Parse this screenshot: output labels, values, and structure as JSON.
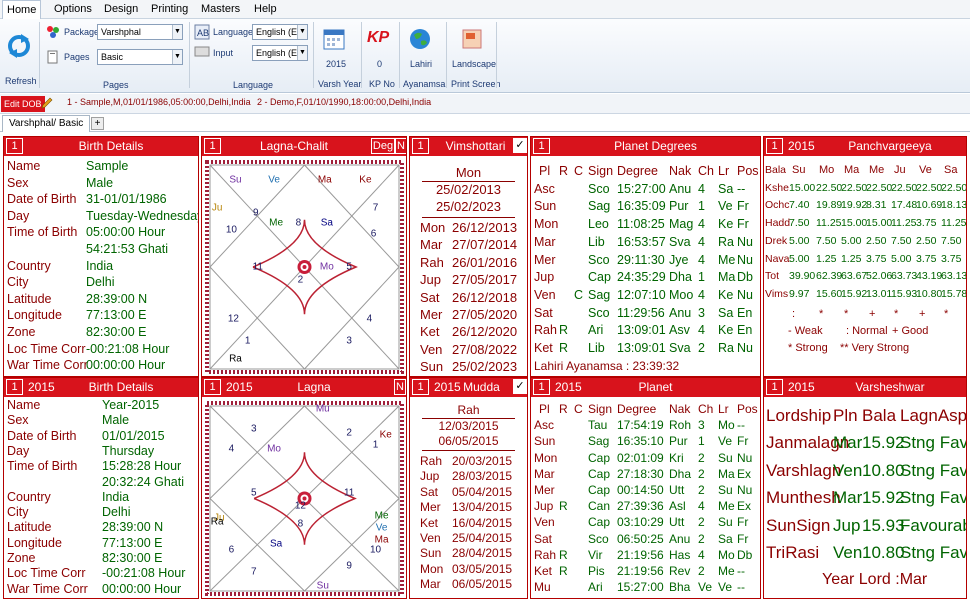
{
  "menu": [
    "Home",
    "Options",
    "Design",
    "Printing",
    "Masters",
    "Help"
  ],
  "ribbon": {
    "refresh": "Refresh",
    "package_label": "Package",
    "package_value": "Varshphal",
    "pages_label": "Pages",
    "pages_value": "Basic",
    "group_pages": "Pages",
    "language_label": "Language",
    "language_value": "English (E",
    "input_label": "Input",
    "input_value": "English (E",
    "group_language": "Language",
    "varsh_year": "2015",
    "varsh_year_label": "Varsh Year",
    "kp_icon": "KP",
    "kp_no": "0",
    "kp_no_label": "KP No",
    "ayanamsa": "Lahiri",
    "ayanamsa_label": "Ayanamsa",
    "print_screen": "Landscape",
    "print_screen_label": "Print Screen"
  },
  "edit_dob": "Edit DOB",
  "profiles": [
    "1 - Sample,M,01/01/1986,05:00:00,Delhi,India",
    "2 - Demo,F,01/10/1990,18:00:00,Delhi,India"
  ],
  "doc_tab": "Varshphal/ Basic",
  "add_tab": "+",
  "p_birth": {
    "num": "1",
    "title": "Birth Details",
    "rows": [
      [
        "Name",
        "Sample"
      ],
      [
        "Sex",
        "Male"
      ],
      [
        "Date of Birth",
        "31-01/01/1986"
      ],
      [
        "Day",
        "Tuesday-Wednesday"
      ],
      [
        "Time of Birth",
        "05:00:00 Hour"
      ],
      [
        "",
        "54:21:53 Ghati"
      ],
      [
        "Country",
        "India"
      ],
      [
        "City",
        "Delhi"
      ],
      [
        "Latitude",
        "28:39:00 N"
      ],
      [
        "Longitude",
        "77:13:00 E"
      ],
      [
        "Zone",
        "82:30:00 E"
      ],
      [
        "Loc Time Corr",
        "-00:21:08 Hour"
      ],
      [
        "War Time Corr",
        "00:00:00 Hour"
      ]
    ]
  },
  "p_chalit": {
    "num": "1",
    "title": "Lagna-Chalit",
    "deg": "Deg",
    "n": "N",
    "houses": [
      "11",
      "2",
      "12",
      "5",
      "1",
      "10",
      "4",
      "3",
      "7",
      "8",
      "6",
      "9"
    ],
    "planets": [
      {
        "t": "Su",
        "c": "#7030a0"
      },
      {
        "t": "Ve",
        "c": "#1f6fb0"
      },
      {
        "t": "Ma",
        "c": "#8b0000"
      },
      {
        "t": "Ke",
        "c": "#8b0000"
      },
      {
        "t": "Ju",
        "c": "#b8860b"
      },
      {
        "t": "Me",
        "c": "#006400"
      },
      {
        "t": "Sa",
        "c": "#000080"
      },
      {
        "t": "Mo",
        "c": "#7030a0"
      },
      {
        "t": "Ra",
        "c": "#000000"
      }
    ]
  },
  "p_vim": {
    "num": "1",
    "title": "Vimshottari",
    "check": "✓",
    "head": "Mon",
    "range": [
      "25/02/2013",
      "25/02/2023"
    ],
    "rows": [
      [
        "Mon",
        "26/12/2013"
      ],
      [
        "Mar",
        "27/07/2014"
      ],
      [
        "Rah",
        "26/01/2016"
      ],
      [
        "Jup",
        "27/05/2017"
      ],
      [
        "Sat",
        "26/12/2018"
      ],
      [
        "Mer",
        "27/05/2020"
      ],
      [
        "Ket",
        "26/12/2020"
      ],
      [
        "Ven",
        "27/08/2022"
      ],
      [
        "Sun",
        "25/02/2023"
      ]
    ]
  },
  "p_pdeg": {
    "num": "1",
    "title": "Planet Degrees",
    "cols": [
      "Pl",
      "R",
      "C",
      "Sign",
      "Degree",
      "Nak",
      "Ch",
      "Lr",
      "Pos"
    ],
    "rows": [
      [
        "Asc",
        "",
        "",
        "Sco",
        "15:27:00",
        "Anu",
        "4",
        "Sa",
        "--"
      ],
      [
        "Sun",
        "",
        "",
        "Sag",
        "16:35:09",
        "Pur",
        "1",
        "Ve",
        "Fr"
      ],
      [
        "Mon",
        "",
        "",
        "Leo",
        "11:08:25",
        "Mag",
        "4",
        "Ke",
        "Fr"
      ],
      [
        "Mar",
        "",
        "",
        "Lib",
        "16:53:57",
        "Sva",
        "4",
        "Ra",
        "Nu"
      ],
      [
        "Mer",
        "",
        "",
        "Sco",
        "29:11:30",
        "Jye",
        "4",
        "Me",
        "Nu"
      ],
      [
        "Jup",
        "",
        "",
        "Cap",
        "24:35:29",
        "Dha",
        "1",
        "Ma",
        "Db"
      ],
      [
        "Ven",
        "",
        "C",
        "Sag",
        "12:07:10",
        "Moo",
        "4",
        "Ke",
        "Nu"
      ],
      [
        "Sat",
        "",
        "",
        "Sco",
        "11:29:56",
        "Anu",
        "3",
        "Sa",
        "En"
      ],
      [
        "Rah",
        "R",
        "",
        "Ari",
        "13:09:01",
        "Asv",
        "4",
        "Ke",
        "En"
      ],
      [
        "Ket",
        "R",
        "",
        "Lib",
        "13:09:01",
        "Sva",
        "2",
        "Ra",
        "Nu"
      ]
    ],
    "ayanamsa": "Lahiri Ayanamsa : 23:39:32"
  },
  "p_panch": {
    "num": "1",
    "year": "2015",
    "title": "Panchvargeeya",
    "cols": [
      "",
      "Su",
      "Mo",
      "Ma",
      "Me",
      "Ju",
      "Ve",
      "Sa"
    ],
    "rows": [
      [
        "Bala",
        "",
        "",
        "",
        "",
        "",
        "",
        ""
      ],
      [
        "Kshe",
        "15.00",
        "22.50",
        "22.50",
        "22.50",
        "22.50",
        "22.50",
        "22.50"
      ],
      [
        "Ochc",
        "7.40",
        "19.89",
        "19.92",
        "8.31",
        "17.48",
        "10.69",
        "18.13"
      ],
      [
        "Hadd",
        "7.50",
        "11.25",
        "15.00",
        "15.00",
        "11.25",
        "3.75",
        "11.25"
      ],
      [
        "Drek",
        "5.00",
        "7.50",
        "5.00",
        "2.50",
        "7.50",
        "2.50",
        "7.50"
      ],
      [
        "Nava",
        "5.00",
        "1.25",
        "1.25",
        "3.75",
        "5.00",
        "3.75",
        "3.75"
      ],
      [
        "Tot",
        "39.90",
        "62.39",
        "63.67",
        "52.06",
        "63.73",
        "43.19",
        "63.13"
      ],
      [
        "Vims",
        "9.97",
        "15.60",
        "15.92",
        "13.01",
        "15.93",
        "10.80",
        "15.78"
      ]
    ],
    "marks": [
      ":",
      "*",
      "*",
      "+",
      "*",
      "+",
      "*"
    ],
    "legend": [
      "- Weak",
      ": Normal",
      "+ Good",
      "* Strong",
      "** Very Strong"
    ]
  },
  "p_birth2": {
    "num": "1",
    "year": "2015",
    "title": "Birth Details",
    "rows": [
      [
        "Name",
        "Year-2015"
      ],
      [
        "Sex",
        "Male"
      ],
      [
        "Date of Birth",
        "01/01/2015"
      ],
      [
        "Day",
        "Thursday"
      ],
      [
        "Time of Birth",
        "15:28:28 Hour"
      ],
      [
        "",
        "20:32:24 Ghati"
      ],
      [
        "Country",
        "India"
      ],
      [
        "City",
        "Delhi"
      ],
      [
        "Latitude",
        "28:39:00 N"
      ],
      [
        "Longitude",
        "77:13:00 E"
      ],
      [
        "Zone",
        "82:30:00 E"
      ],
      [
        "Loc Time Corr",
        "-00:21:08 Hour"
      ],
      [
        "War Time Corr",
        "00:00:00 Hour"
      ]
    ]
  },
  "p_lagna": {
    "num": "1",
    "year": "2015",
    "title": "Lagna",
    "n": "N",
    "houses": [
      "3",
      "12",
      "4",
      "11",
      "5",
      "8",
      "6",
      "7",
      "1",
      "2",
      "9",
      "10"
    ],
    "planets": [
      {
        "t": "Mu",
        "c": "#7030a0"
      },
      {
        "t": "Ke",
        "c": "#8b0000"
      },
      {
        "t": "Mo",
        "c": "#7030a0"
      },
      {
        "t": "Ju",
        "c": "#b8860b"
      },
      {
        "t": "Ra",
        "c": "#000000"
      },
      {
        "t": "Sa",
        "c": "#000080"
      },
      {
        "t": "Me",
        "c": "#006400"
      },
      {
        "t": "Ve",
        "c": "#1f6fb0"
      },
      {
        "t": "Ma",
        "c": "#8b0000"
      },
      {
        "t": "Su",
        "c": "#7030a0"
      }
    ]
  },
  "p_mudda": {
    "num": "1",
    "year": "2015",
    "title": "Mudda",
    "check": "✓",
    "head": "Rah",
    "range": [
      "12/03/2015",
      "06/05/2015"
    ],
    "rows": [
      [
        "Rah",
        "20/03/2015"
      ],
      [
        "Jup",
        "28/03/2015"
      ],
      [
        "Sat",
        "05/04/2015"
      ],
      [
        "Mer",
        "13/04/2015"
      ],
      [
        "Ket",
        "16/04/2015"
      ],
      [
        "Ven",
        "25/04/2015"
      ],
      [
        "Sun",
        "28/04/2015"
      ],
      [
        "Mon",
        "03/05/2015"
      ],
      [
        "Mar",
        "06/05/2015"
      ]
    ]
  },
  "p_planet": {
    "num": "1",
    "year": "2015",
    "title": "Planet",
    "cols": [
      "Pl",
      "R",
      "C",
      "Sign",
      "Degree",
      "Nak",
      "Ch",
      "Lr",
      "Pos"
    ],
    "rows": [
      [
        "Asc",
        "",
        "",
        "Tau",
        "17:54:19",
        "Roh",
        "3",
        "Mo",
        "--"
      ],
      [
        "Sun",
        "",
        "",
        "Sag",
        "16:35:10",
        "Pur",
        "1",
        "Ve",
        "Fr"
      ],
      [
        "Mon",
        "",
        "",
        "Cap",
        "02:01:09",
        "Kri",
        "2",
        "Su",
        "Nu"
      ],
      [
        "Mar",
        "",
        "",
        "Cap",
        "27:18:30",
        "Dha",
        "2",
        "Ma",
        "Ex"
      ],
      [
        "Mer",
        "",
        "",
        "Cap",
        "00:14:50",
        "Utt",
        "2",
        "Su",
        "Nu"
      ],
      [
        "Jup",
        "R",
        "",
        "Can",
        "27:39:36",
        "Asl",
        "4",
        "Me",
        "Ex"
      ],
      [
        "Ven",
        "",
        "",
        "Cap",
        "03:10:29",
        "Utt",
        "2",
        "Su",
        "Fr"
      ],
      [
        "Sat",
        "",
        "",
        "Sco",
        "06:50:25",
        "Anu",
        "2",
        "Sa",
        "Fr"
      ],
      [
        "Rah",
        "R",
        "",
        "Vir",
        "21:19:56",
        "Has",
        "4",
        "Mo",
        "Db"
      ],
      [
        "Ket",
        "R",
        "",
        "Pis",
        "21:19:56",
        "Rev",
        "2",
        "Me",
        "--"
      ],
      [
        "Mu",
        "",
        "",
        "Ari",
        "15:27:00",
        "Bha",
        "Ve",
        "Ve",
        "--"
      ]
    ]
  },
  "p_varsh": {
    "num": "1",
    "year": "2015",
    "title": "Varsheshwar",
    "cols": [
      "Lordship",
      "Pln",
      "Bala",
      "LagnAspct"
    ],
    "rows": [
      [
        "Janmalagn",
        "Mar",
        "15.92",
        "Stng Favbl"
      ],
      [
        "Varshlagn",
        "Ven",
        "10.80",
        "Stng Favbl"
      ],
      [
        "Munthesh",
        "Mar",
        "15.92",
        "Stng Favbl"
      ],
      [
        "SunSign",
        "Jup",
        "15.93",
        "Favourable"
      ],
      [
        "TriRasi",
        "Ven",
        "10.80",
        "Stng Favbl"
      ]
    ],
    "year_lord": "Year Lord :Mar"
  },
  "colors": {
    "header": "#d8131c",
    "dark_red": "#8b0000",
    "dark_green": "#006400"
  }
}
